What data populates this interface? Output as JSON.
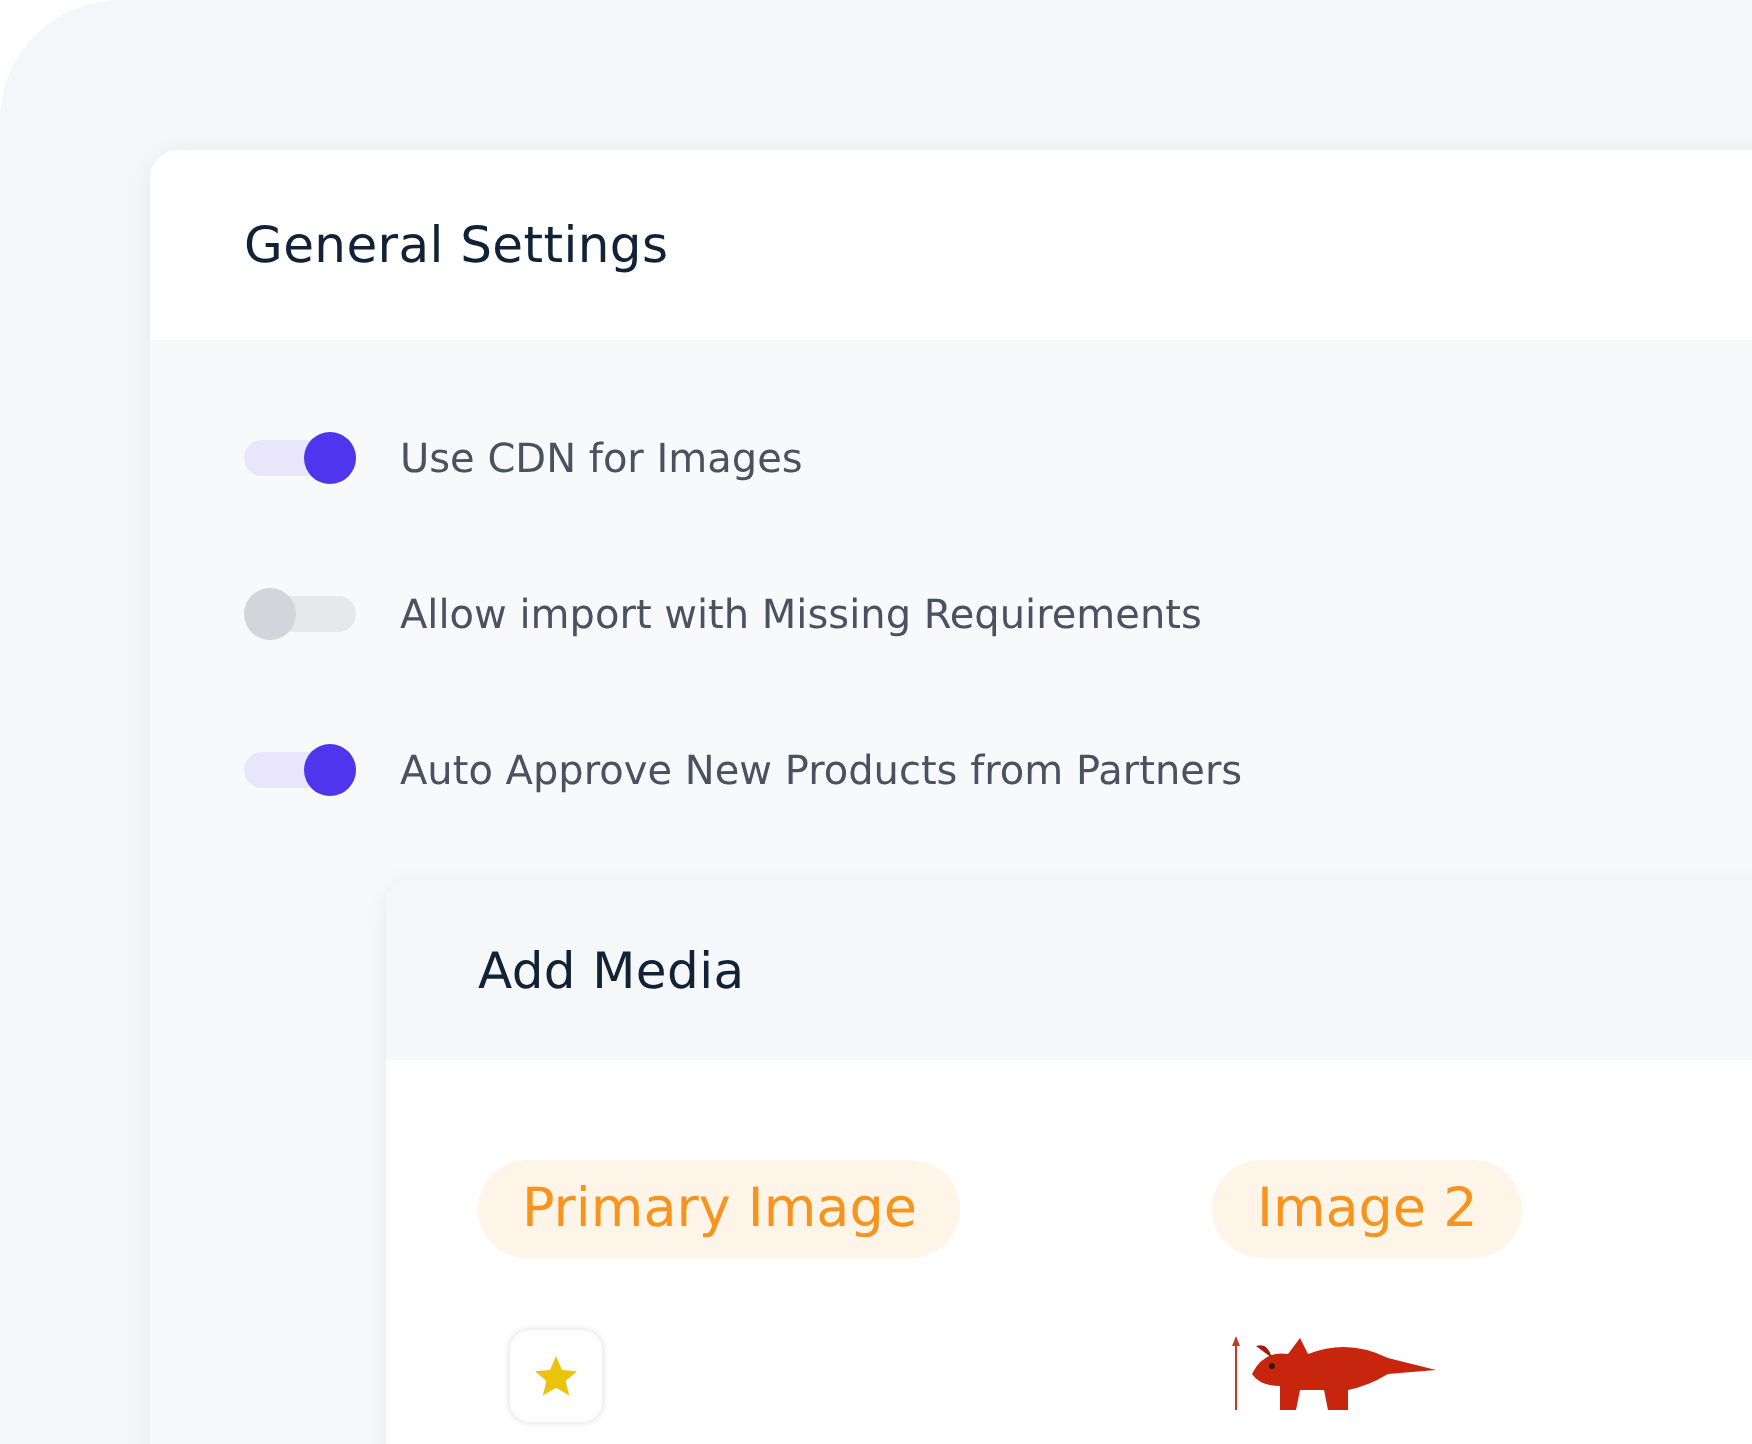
{
  "settings": {
    "title": "General Settings",
    "toggles": [
      {
        "label": "Use CDN for Images",
        "on": true
      },
      {
        "label": "Allow import with Missing Requirements",
        "on": false
      },
      {
        "label": "Auto Approve New Products from Partners",
        "on": true
      }
    ]
  },
  "media": {
    "title": "Add Media",
    "slots": [
      {
        "label": "Primary Image",
        "kind": "star"
      },
      {
        "label": "Image 2",
        "kind": "picture"
      }
    ]
  }
}
